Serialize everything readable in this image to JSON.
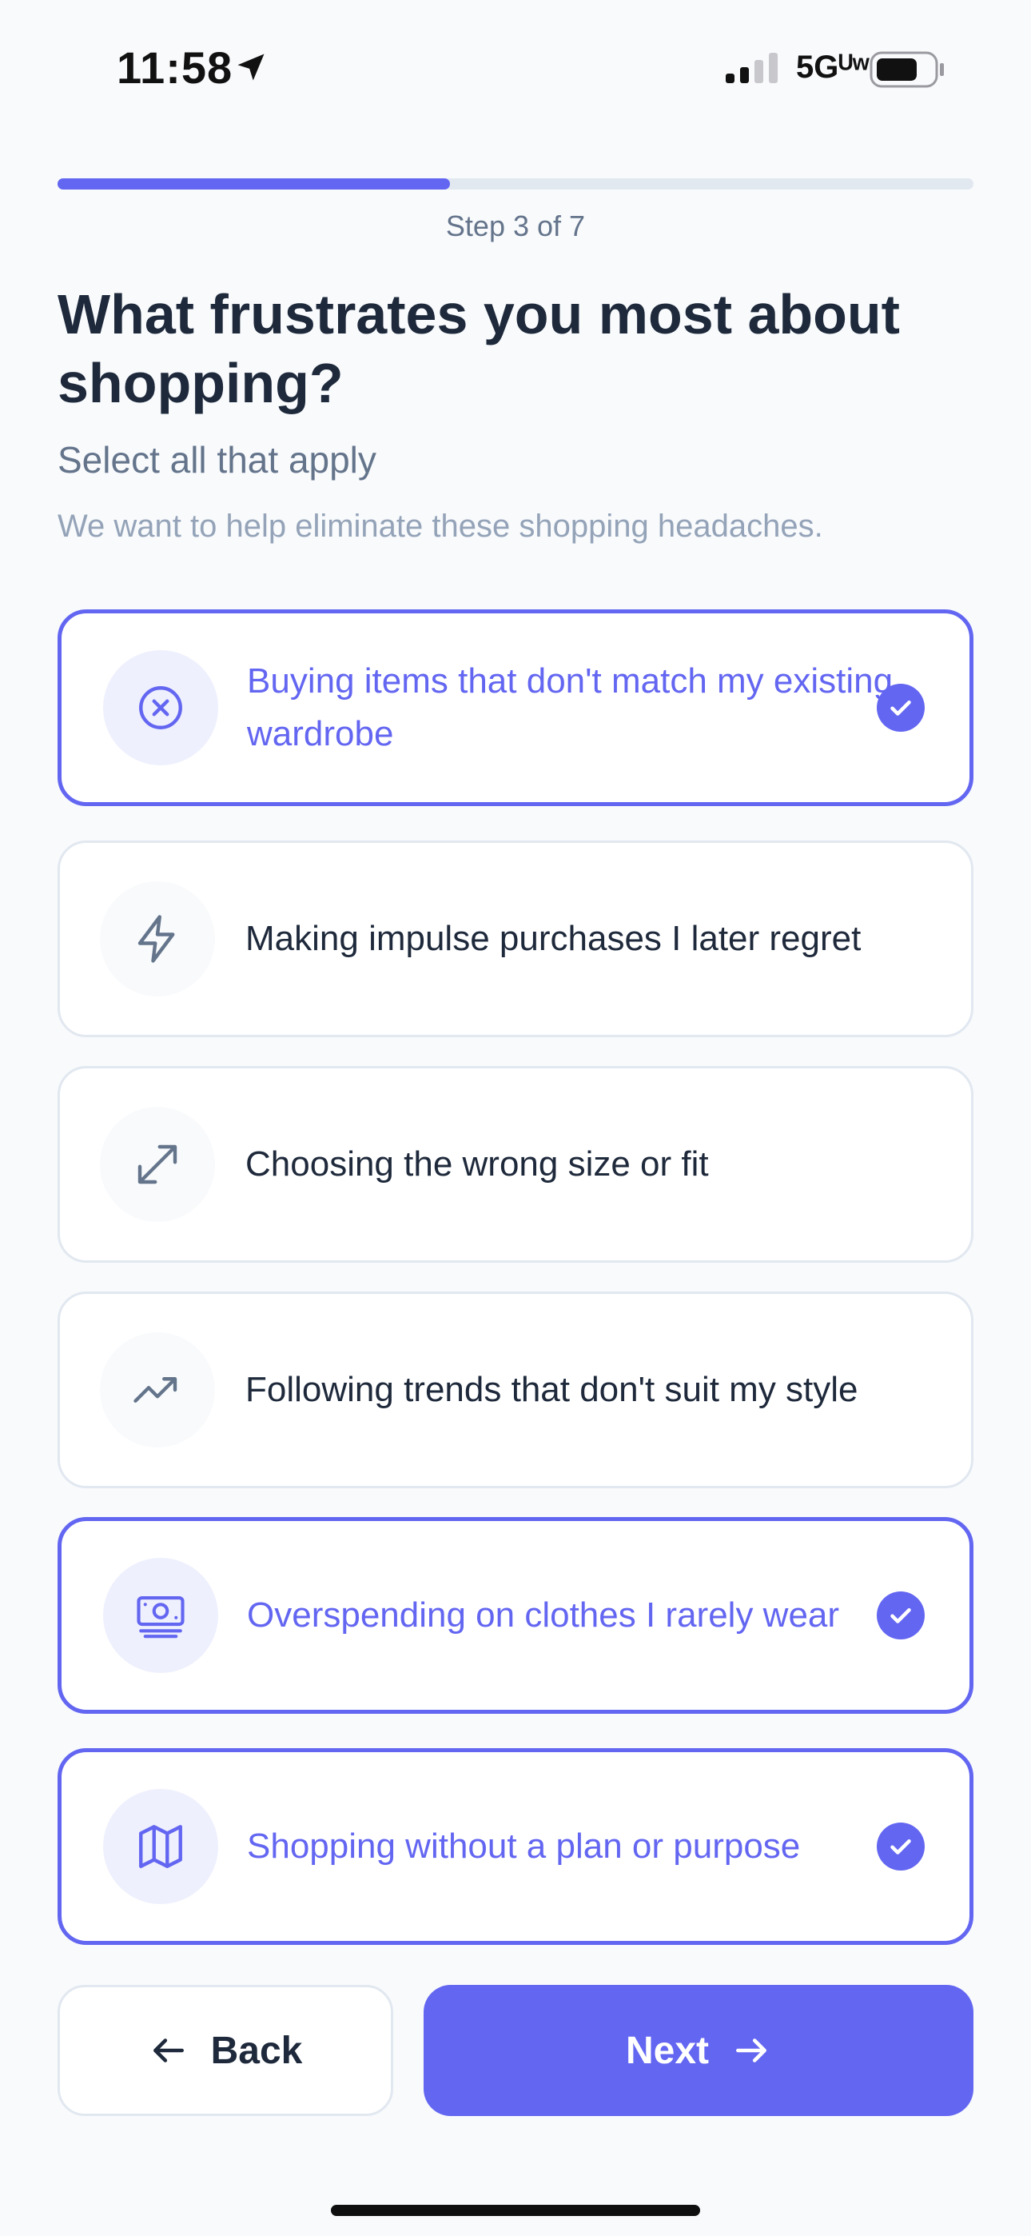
{
  "status_bar": {
    "time": "11:58",
    "network": "5Gᵁʷ",
    "icons": [
      "location-arrow-icon",
      "signal-icon",
      "battery-icon"
    ]
  },
  "progress": {
    "step_label": "Step 3 of 7",
    "fraction": 0.4286
  },
  "header": {
    "title": "What frustrates you most about shopping?",
    "subtitle": "Select all that apply",
    "helper": "We want to help eliminate these shopping headaches."
  },
  "options": [
    {
      "label": "Buying items that don't match my existing wardrobe",
      "icon": "x-circle-icon",
      "selected": true
    },
    {
      "label": "Making impulse purchases I later regret",
      "icon": "lightning-icon",
      "selected": false
    },
    {
      "label": "Choosing the wrong size or fit",
      "icon": "expand-arrows-icon",
      "selected": false
    },
    {
      "label": "Following trends that don't suit my style",
      "icon": "trending-up-icon",
      "selected": false
    },
    {
      "label": "Overspending on clothes I rarely wear",
      "icon": "cash-icon",
      "selected": true
    },
    {
      "label": "Shopping without a plan or purpose",
      "icon": "map-icon",
      "selected": true
    }
  ],
  "buttons": {
    "back_label": "Back",
    "next_label": "Next"
  },
  "colors": {
    "accent": "#6366f1",
    "text": "#1e293b",
    "muted": "#64748b",
    "border": "#e2e8f0",
    "background": "#f8fafc"
  }
}
